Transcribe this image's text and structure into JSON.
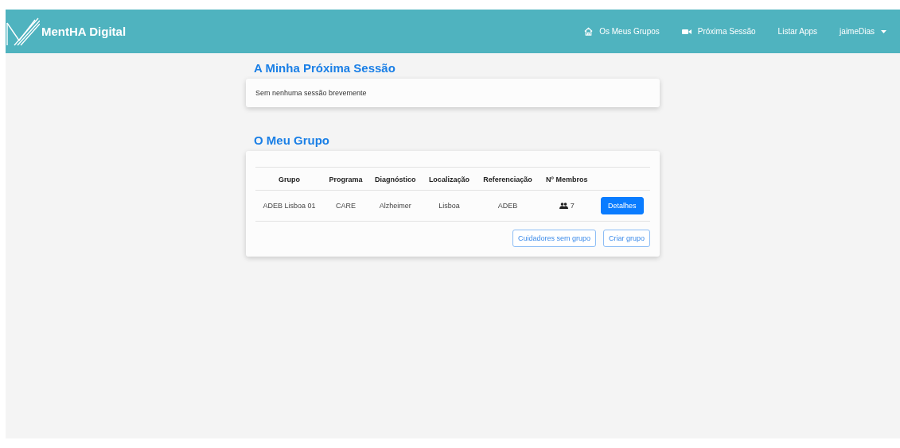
{
  "navbar": {
    "brand": "MentHA Digital",
    "links": [
      {
        "kind": "home",
        "label": "Os Meus Grupos"
      },
      {
        "kind": "video",
        "label": "Próxima Sessão"
      },
      {
        "kind": "plain",
        "label": "Listar Apps"
      },
      {
        "kind": "dropdown",
        "label": "jaimeDias"
      }
    ]
  },
  "next_session": {
    "title": "A Minha Próxima Sessão",
    "message": "Sem nenhuma sessão brevemente"
  },
  "group": {
    "title": "O Meu Grupo",
    "table": {
      "columns": [
        "Grupo",
        "Programa",
        "Diagnóstico",
        "Localização",
        "Referenciação",
        "Nº Membros"
      ],
      "rows": [
        {
          "cells": [
            "ADEB Lisboa 01",
            "CARE",
            "Alzheimer",
            "Lisboa",
            "ADEB"
          ],
          "members": "7",
          "action": "Detalhes"
        }
      ]
    },
    "buttons": [
      "Cuidadores sem grupo",
      "Criar grupo"
    ]
  }
}
